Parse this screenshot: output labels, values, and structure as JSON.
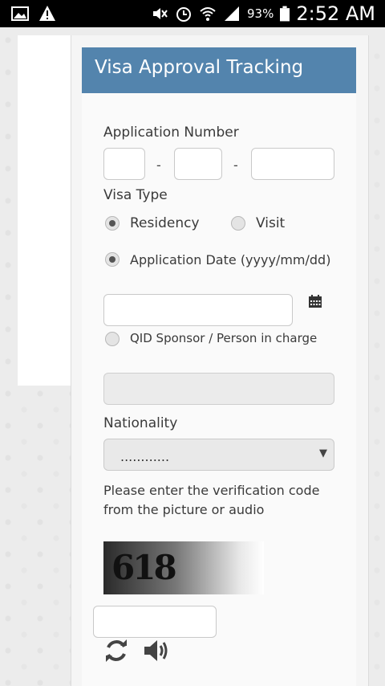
{
  "status_bar": {
    "battery": "93%",
    "time": "2:52 AM",
    "left_icons": [
      "image-icon",
      "warning-icon"
    ],
    "right_icons": [
      "mute-icon",
      "alarm-icon",
      "wifi-icon",
      "signal-icon",
      "battery-icon"
    ]
  },
  "header": {
    "title": "Visa Approval Tracking"
  },
  "form": {
    "application_number_label": "Application Number",
    "separator": "-",
    "visa_type_label": "Visa Type",
    "visa_options": [
      {
        "label": "Residency",
        "selected": true
      },
      {
        "label": "Visit",
        "selected": false
      }
    ],
    "application_date_label": "Application Date  (yyyy/mm/dd)",
    "application_date_selected": true,
    "calendar_icon": "calendar-icon",
    "qid_label": "QID Sponsor / Person in charge",
    "qid_selected": false,
    "nationality_label": "Nationality",
    "nationality_value": "............",
    "verification_text_line1": "Please enter the verification code",
    "verification_text_line2": "from the picture or audio",
    "captcha_text": "618",
    "refresh_icon": "refresh-icon",
    "audio_icon": "speaker-icon"
  }
}
